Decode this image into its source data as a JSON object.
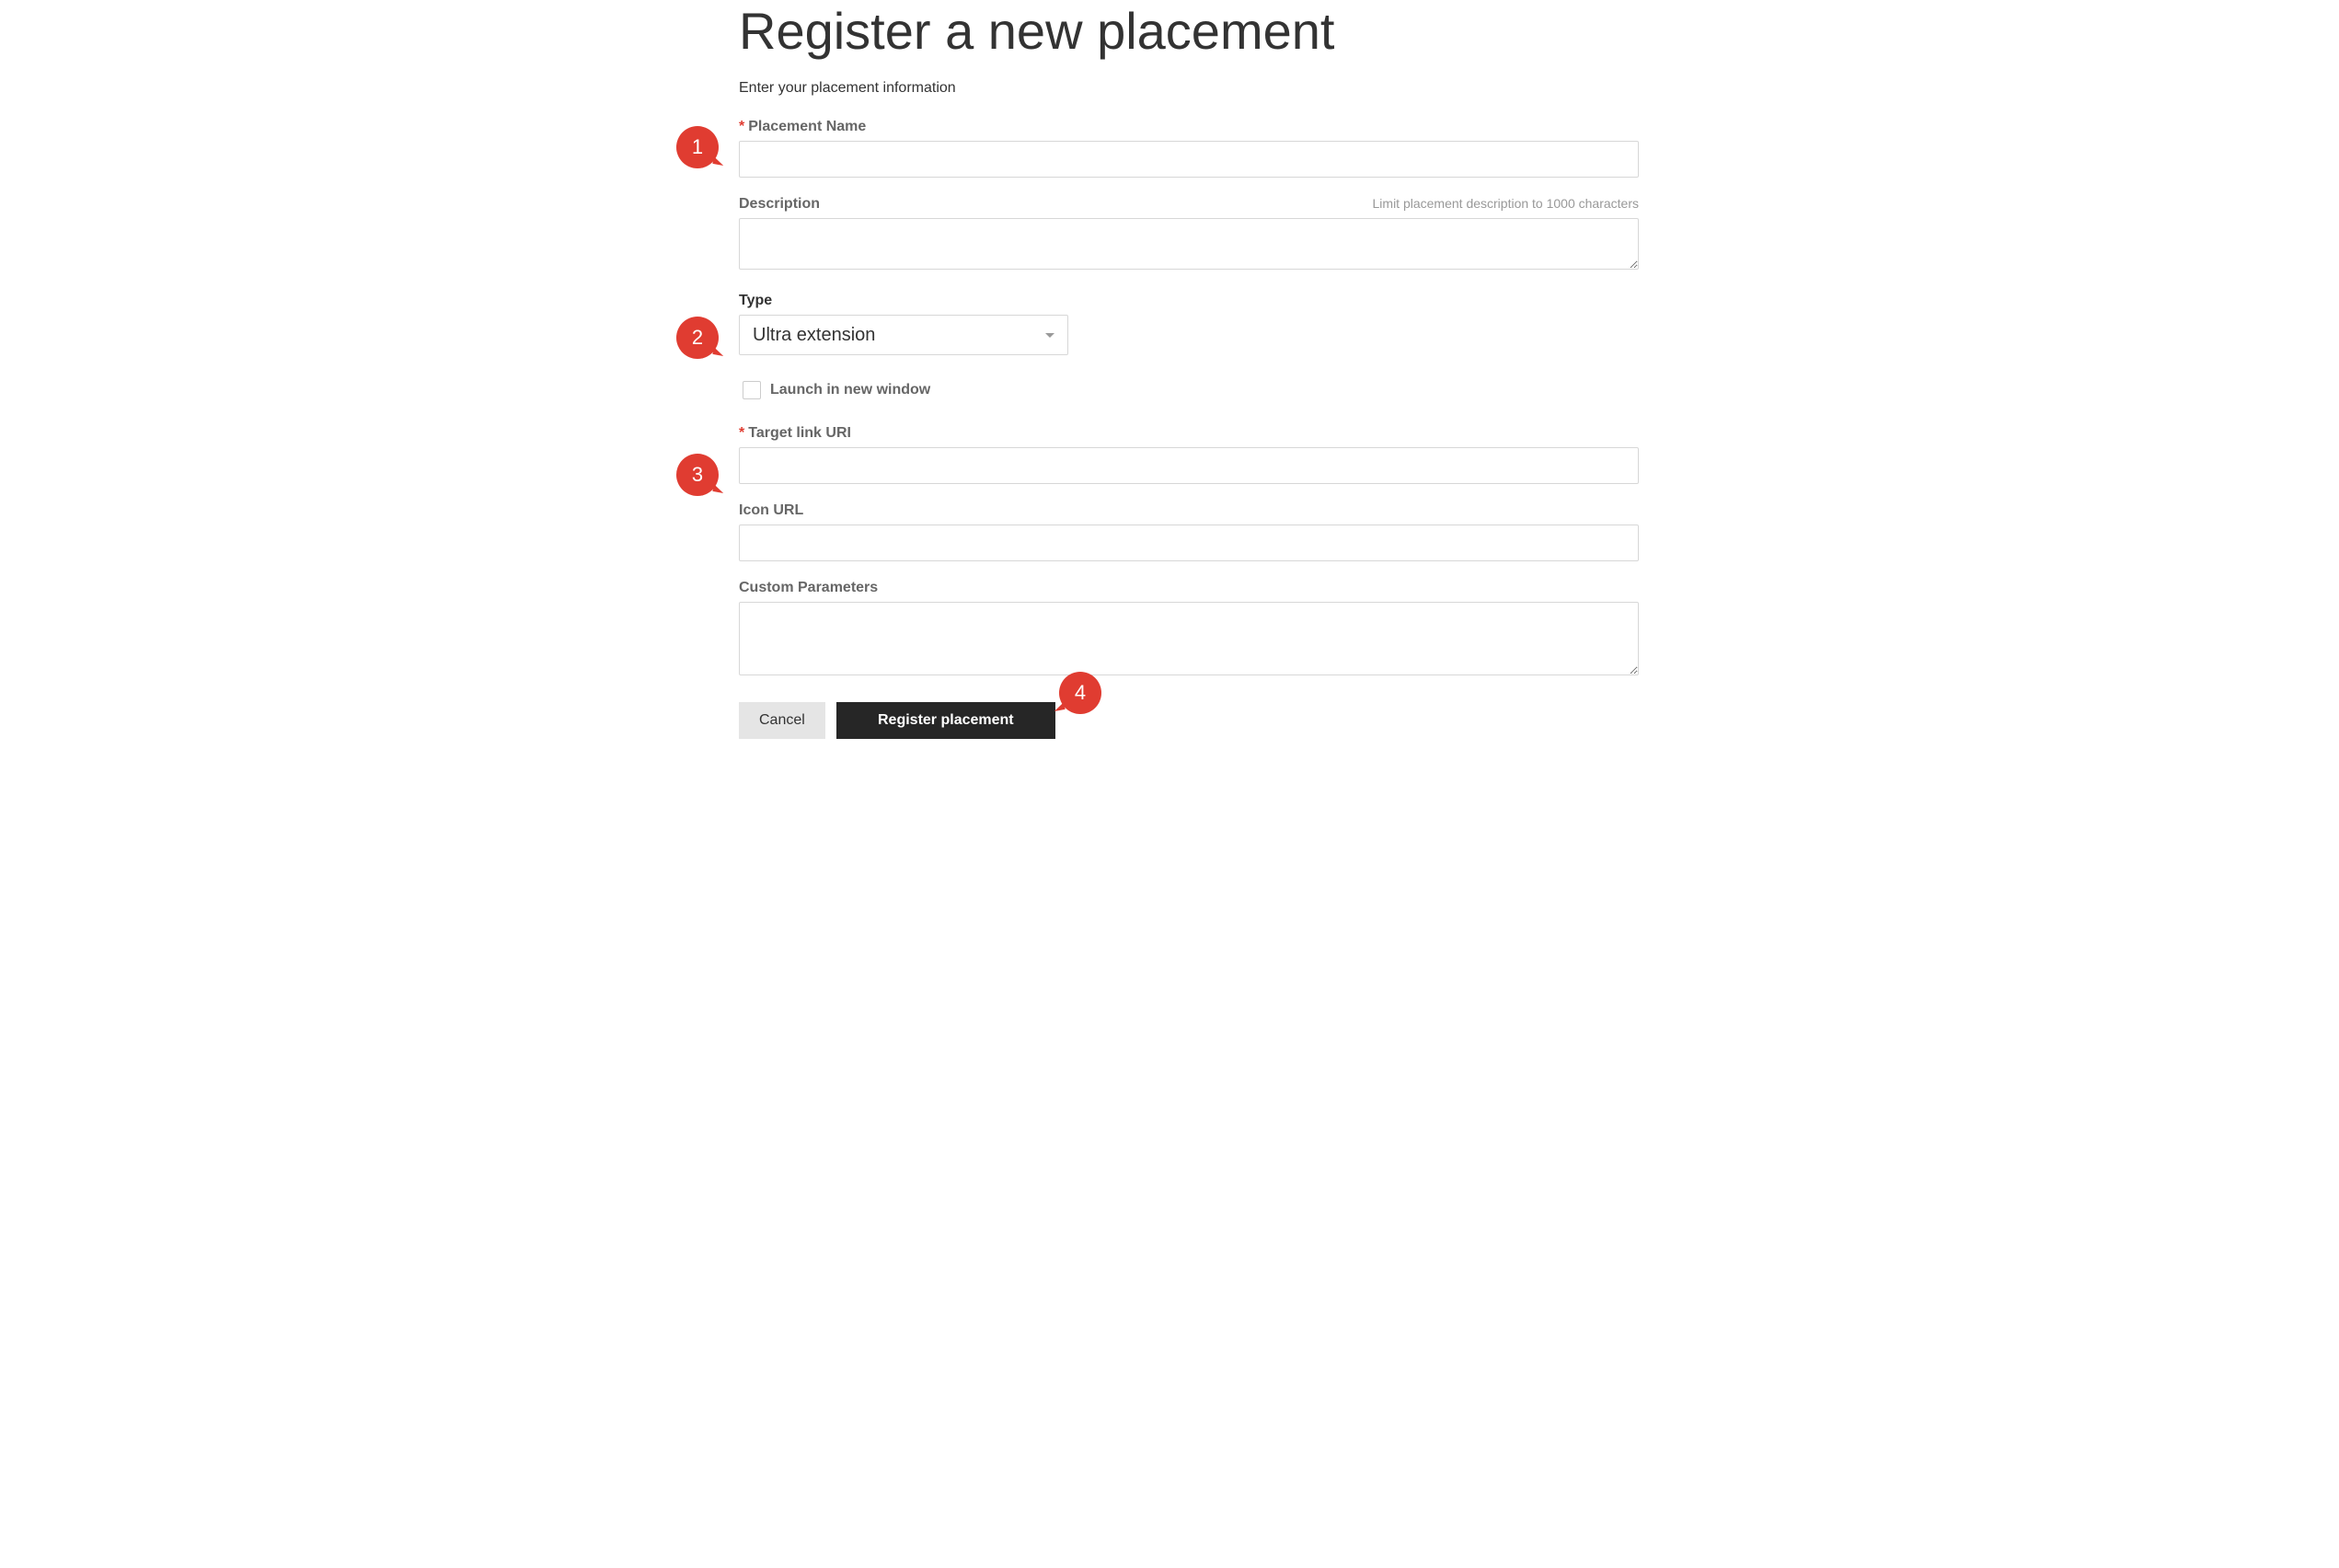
{
  "page": {
    "title": "Register a new placement",
    "subtitle": "Enter your placement information"
  },
  "callouts": {
    "one": "1",
    "two": "2",
    "three": "3",
    "four": "4"
  },
  "fields": {
    "placement_name": {
      "label": "Placement Name",
      "value": ""
    },
    "description": {
      "label": "Description",
      "hint": "Limit placement description to 1000 characters",
      "value": ""
    },
    "type": {
      "label": "Type",
      "selected": "Ultra extension"
    },
    "launch_new_window": {
      "label": "Launch in new window",
      "checked": false
    },
    "target_link_uri": {
      "label": "Target link URI",
      "value": ""
    },
    "icon_url": {
      "label": "Icon URL",
      "value": ""
    },
    "custom_parameters": {
      "label": "Custom Parameters",
      "value": ""
    }
  },
  "actions": {
    "cancel": "Cancel",
    "submit": "Register placement"
  }
}
